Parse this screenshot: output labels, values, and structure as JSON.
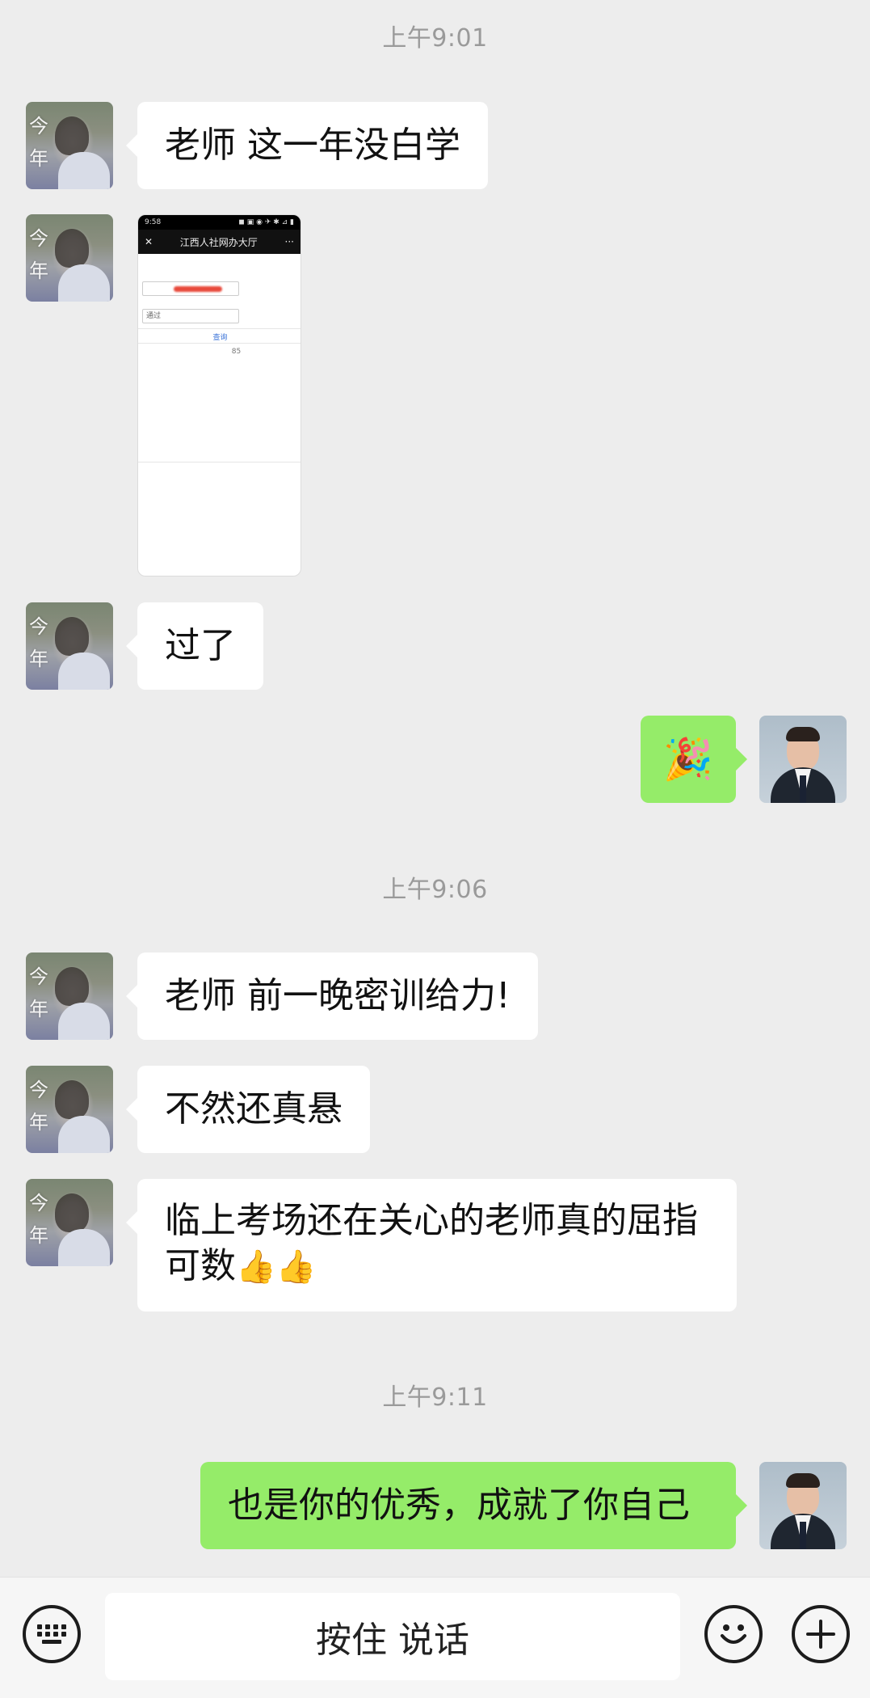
{
  "timestamps": [
    "上午9:01",
    "上午9:06",
    "上午9:11"
  ],
  "messages": {
    "m1": "老师 这一年没白学",
    "m3": "过了",
    "m4_emoji": "🎉",
    "m5": "老师 前一晚密训给力!",
    "m6": "不然还真悬",
    "m7_line1": "临上考场还在关心的老师真的屈指",
    "m7_line2": "可数",
    "m7_emoji": "👍👍",
    "m8": "也是你的优秀，成就了你自己"
  },
  "screenshot_thumb": {
    "status_left": "9:58",
    "status_right": "◼ ▣ ◉ ✈ ✱ ⊿ ▮",
    "page_title": "江西人社网办大厅",
    "close": "✕",
    "more": "···",
    "field2": "通过",
    "link": "查询",
    "score": "85"
  },
  "avatar_text": "今\n年",
  "input_bar": {
    "voice_label": "按住 说话"
  },
  "icons": {
    "keyboard": "keyboard-icon",
    "emoji": "emoji-icon",
    "plus": "plus-icon"
  },
  "colors": {
    "background": "#ededed",
    "sent_bubble": "#95ec69",
    "received_bubble": "#ffffff"
  }
}
